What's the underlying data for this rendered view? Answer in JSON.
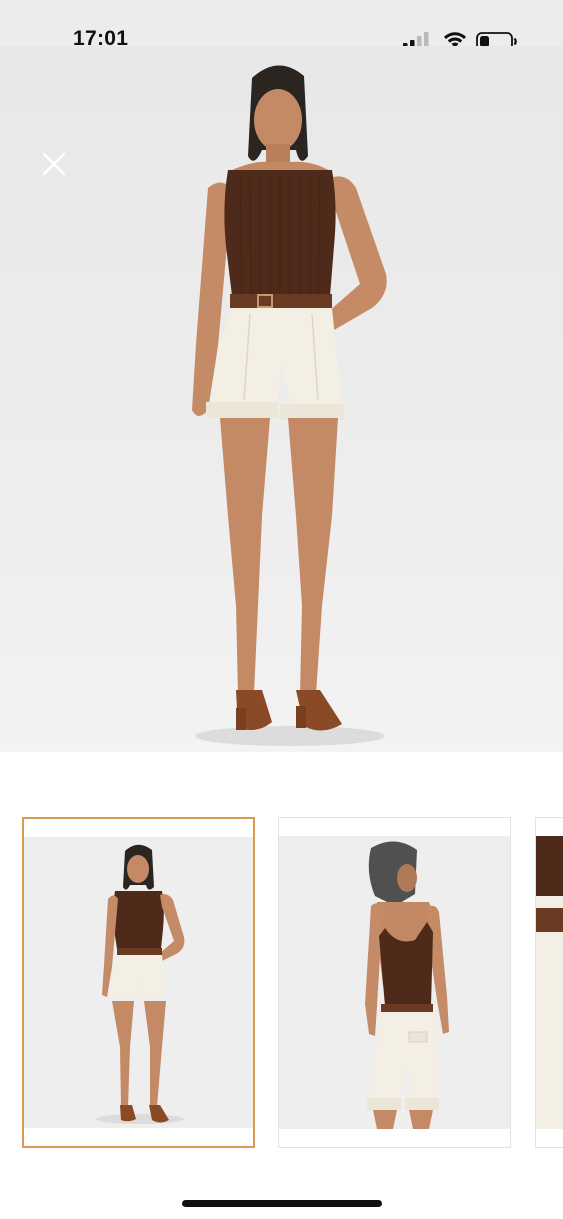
{
  "status_bar": {
    "time": "17:01",
    "signal_icon": "cellular-signal-icon",
    "wifi_icon": "wifi-icon",
    "battery_icon": "battery-low-icon"
  },
  "hero": {
    "close_icon": "close-icon",
    "image": "product-photo-front-view"
  },
  "thumbnails": [
    {
      "view": "front",
      "selected": true
    },
    {
      "view": "back",
      "selected": false
    },
    {
      "view": "detail",
      "selected": false
    }
  ],
  "colors": {
    "selection_border": "#d99a52",
    "top_brown": "#4e2a1a",
    "shorts_cream": "#f3efe4",
    "belt_brown": "#6a3a22",
    "background": "#ececec"
  }
}
